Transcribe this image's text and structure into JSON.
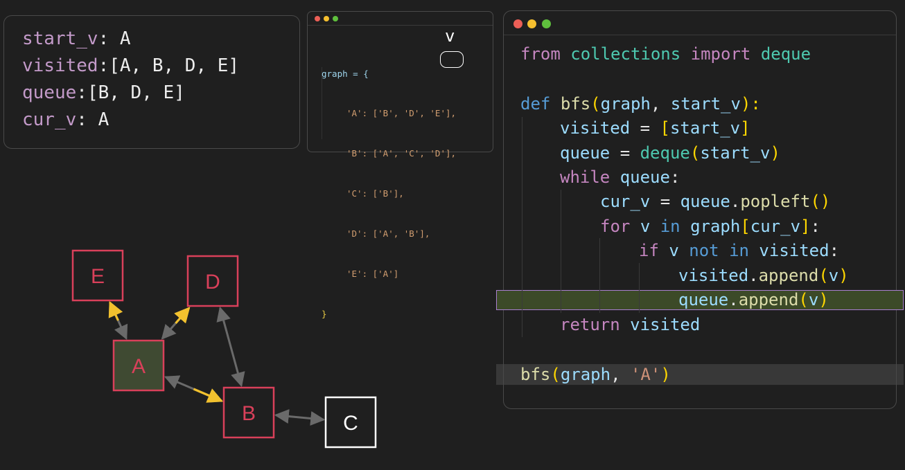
{
  "variables": {
    "start_v": {
      "name": "start_v",
      "value": "A"
    },
    "visited": {
      "name": "visited",
      "value": "[A, B, D, E]"
    },
    "queue": {
      "name": "queue",
      "value": "[B, D, E]"
    },
    "cur_v": {
      "name": "cur_v",
      "value": "A"
    }
  },
  "graph_window": {
    "lines": [
      "graph = {",
      "'A': ['B', 'D', 'E'],",
      "'B': ['A', 'C', 'D'],",
      "'C': ['B'],",
      "'D': ['A', 'B'],",
      "'E': ['A']",
      "}"
    ],
    "pointer_label": "v"
  },
  "code_window": {
    "lines": [
      "from collections import deque",
      "",
      "def bfs(graph, start_v):",
      "visited = [start_v]",
      "queue = deque(start_v)",
      "while queue:",
      "cur_v = queue.popleft()",
      "for v in graph[cur_v]:",
      "if v not in visited:",
      "visited.append(v)",
      "queue.append(v)",
      "return visited",
      "",
      "bfs(graph, 'A')"
    ],
    "active_line_index": 10,
    "call_line_index": 13
  },
  "window_colors": {
    "close": "#ec5f57",
    "minimize": "#f5bf2f",
    "maximize": "#5fc03d"
  },
  "graph": {
    "nodes": [
      {
        "id": "E",
        "label": "E",
        "state": "visited"
      },
      {
        "id": "D",
        "label": "D",
        "state": "visited"
      },
      {
        "id": "A",
        "label": "A",
        "state": "current"
      },
      {
        "id": "B",
        "label": "B",
        "state": "visited"
      },
      {
        "id": "C",
        "label": "C",
        "state": "unvisited"
      }
    ],
    "edges": [
      {
        "from": "A",
        "to": "E",
        "color": "yellow"
      },
      {
        "from": "A",
        "to": "D",
        "color": "yellow"
      },
      {
        "from": "A",
        "to": "B",
        "color": "yellow"
      },
      {
        "from": "D",
        "to": "B",
        "color": "gray"
      },
      {
        "from": "B",
        "to": "C",
        "color": "gray"
      }
    ],
    "colors": {
      "visited": "#d9405a",
      "current_fill": "#3f4a32",
      "unvisited": "#ffffff",
      "yellow": "#f2c12e",
      "gray": "#6a6a6a"
    }
  }
}
